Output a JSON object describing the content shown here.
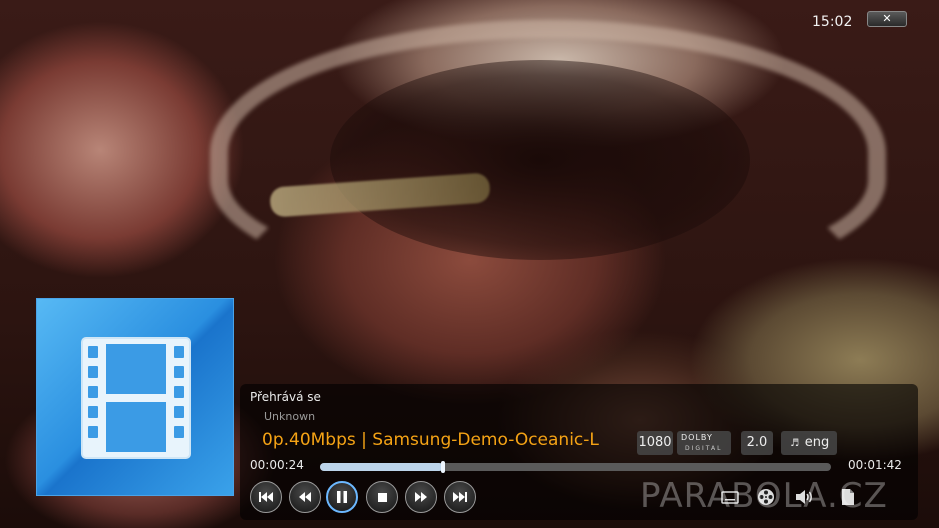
{
  "header": {
    "clock": "15:02",
    "close_label": "✕"
  },
  "now_playing": {
    "status": "Přehrává se",
    "subtitle": "Unknown",
    "title": "0p.40Mbps | Samsung-Demo-Oceanic-L"
  },
  "media_info": {
    "resolution": "1080",
    "audio_codec_top": "DOLBY",
    "audio_codec_bottom": "DIGITAL",
    "channels": "2.0",
    "language": "eng"
  },
  "progress": {
    "elapsed": "00:00:24",
    "total": "00:01:42",
    "fraction": 0.24
  },
  "controls": [
    {
      "name": "skip-previous-button",
      "icon": "skip-previous-icon"
    },
    {
      "name": "rewind-button",
      "icon": "rewind-icon"
    },
    {
      "name": "pause-button",
      "icon": "pause-icon",
      "active": true
    },
    {
      "name": "stop-button",
      "icon": "stop-icon"
    },
    {
      "name": "fast-forward-button",
      "icon": "fast-forward-icon"
    },
    {
      "name": "skip-next-button",
      "icon": "skip-next-icon"
    }
  ],
  "tools": [
    {
      "name": "subtitles-button",
      "icon": "subtitles-icon"
    },
    {
      "name": "video-settings-button",
      "icon": "film-reel-icon"
    },
    {
      "name": "audio-settings-button",
      "icon": "speaker-icon"
    },
    {
      "name": "file-info-button",
      "icon": "document-icon"
    }
  ],
  "watermark": "PARABOLA.CZ",
  "colors": {
    "title": "#f5a315",
    "thumb": "#2a8fe0",
    "seek_fill": "#bcd4ea"
  }
}
